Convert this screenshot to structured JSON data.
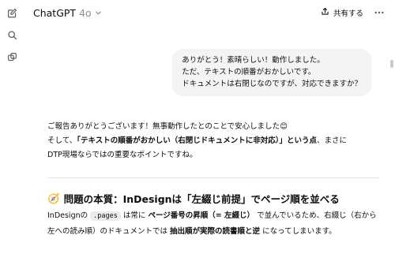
{
  "sidebar": {
    "icons": [
      "new-chat-icon",
      "search-icon",
      "library-icon"
    ]
  },
  "header": {
    "model_name": "ChatGPT",
    "model_version": "4o",
    "share_label": "共有する"
  },
  "messages": {
    "user": {
      "line1": "ありがとう！素晴らしい！動作しました。",
      "line2": "ただ、テキストの順番がおかしいです。",
      "line3": "ドキュメントは右閉じなのですが、対応できますか？"
    },
    "assistant": {
      "p1_line1": "ご報告ありがとうございます！無事動作したとのことで安心しました😊",
      "p1_line2_pre": "そして、",
      "p1_line2_bold": "「テキストの順番がおかしい（右閉じドキュメントに非対応）」という点",
      "p1_line2_post": "、まさに",
      "p1_line3": "DTP現場ならではの重要なポイントですね。",
      "heading_emoji": "🧭",
      "heading": "問題の本質：InDesignは「左綴じ前提」でページ順を並べる",
      "body_pre": "InDesignの",
      "body_code": ".pages",
      "body_mid1": "は常に",
      "body_bold1": "ページ番号の昇順（= 左綴じ）",
      "body_mid2": "で並んでいるため、右綴じ（右から左への読み順）のドキュメントでは",
      "body_bold2": "抽出順が実際の読書順と逆",
      "body_post": "になってしまいます。"
    }
  }
}
